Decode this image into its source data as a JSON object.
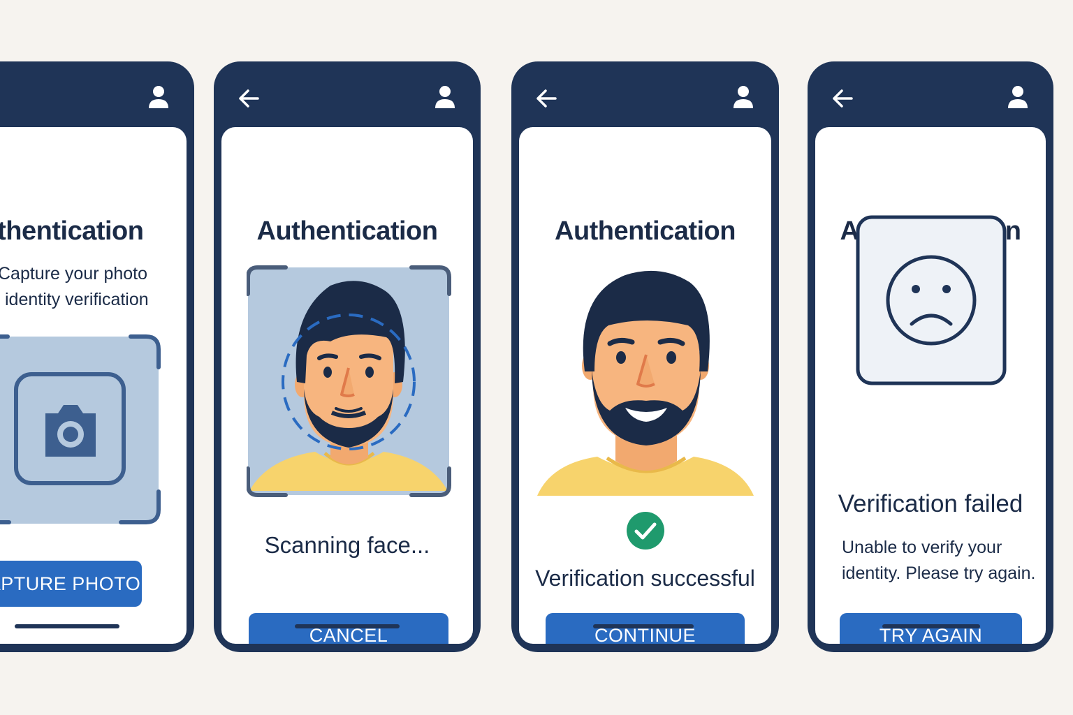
{
  "screens": [
    {
      "title": "Authentication",
      "instruction_line1": "Capture your photo",
      "instruction_line2": "identity verification",
      "button": "CAPTURE PHOTO"
    },
    {
      "title": "Authentication",
      "status": "Scanning face...",
      "button": "CANCEL"
    },
    {
      "title": "Authentication",
      "status": "Verification successful",
      "button": "CONTINUE"
    },
    {
      "title": "Authentication",
      "status": "Verification failed",
      "message_line1": "Unable to verify your",
      "message_line2": "identity. Please try again.",
      "button": "TRY AGAIN"
    }
  ],
  "icons": {
    "back": "arrow-left-icon",
    "profile": "user-icon",
    "camera": "camera-icon",
    "success": "checkmark-icon",
    "failure": "sad-face-icon"
  },
  "colors": {
    "frame": "#1f3457",
    "primary_button": "#2a6bc1",
    "success": "#1f9a6d",
    "background": "#f6f3ef"
  }
}
